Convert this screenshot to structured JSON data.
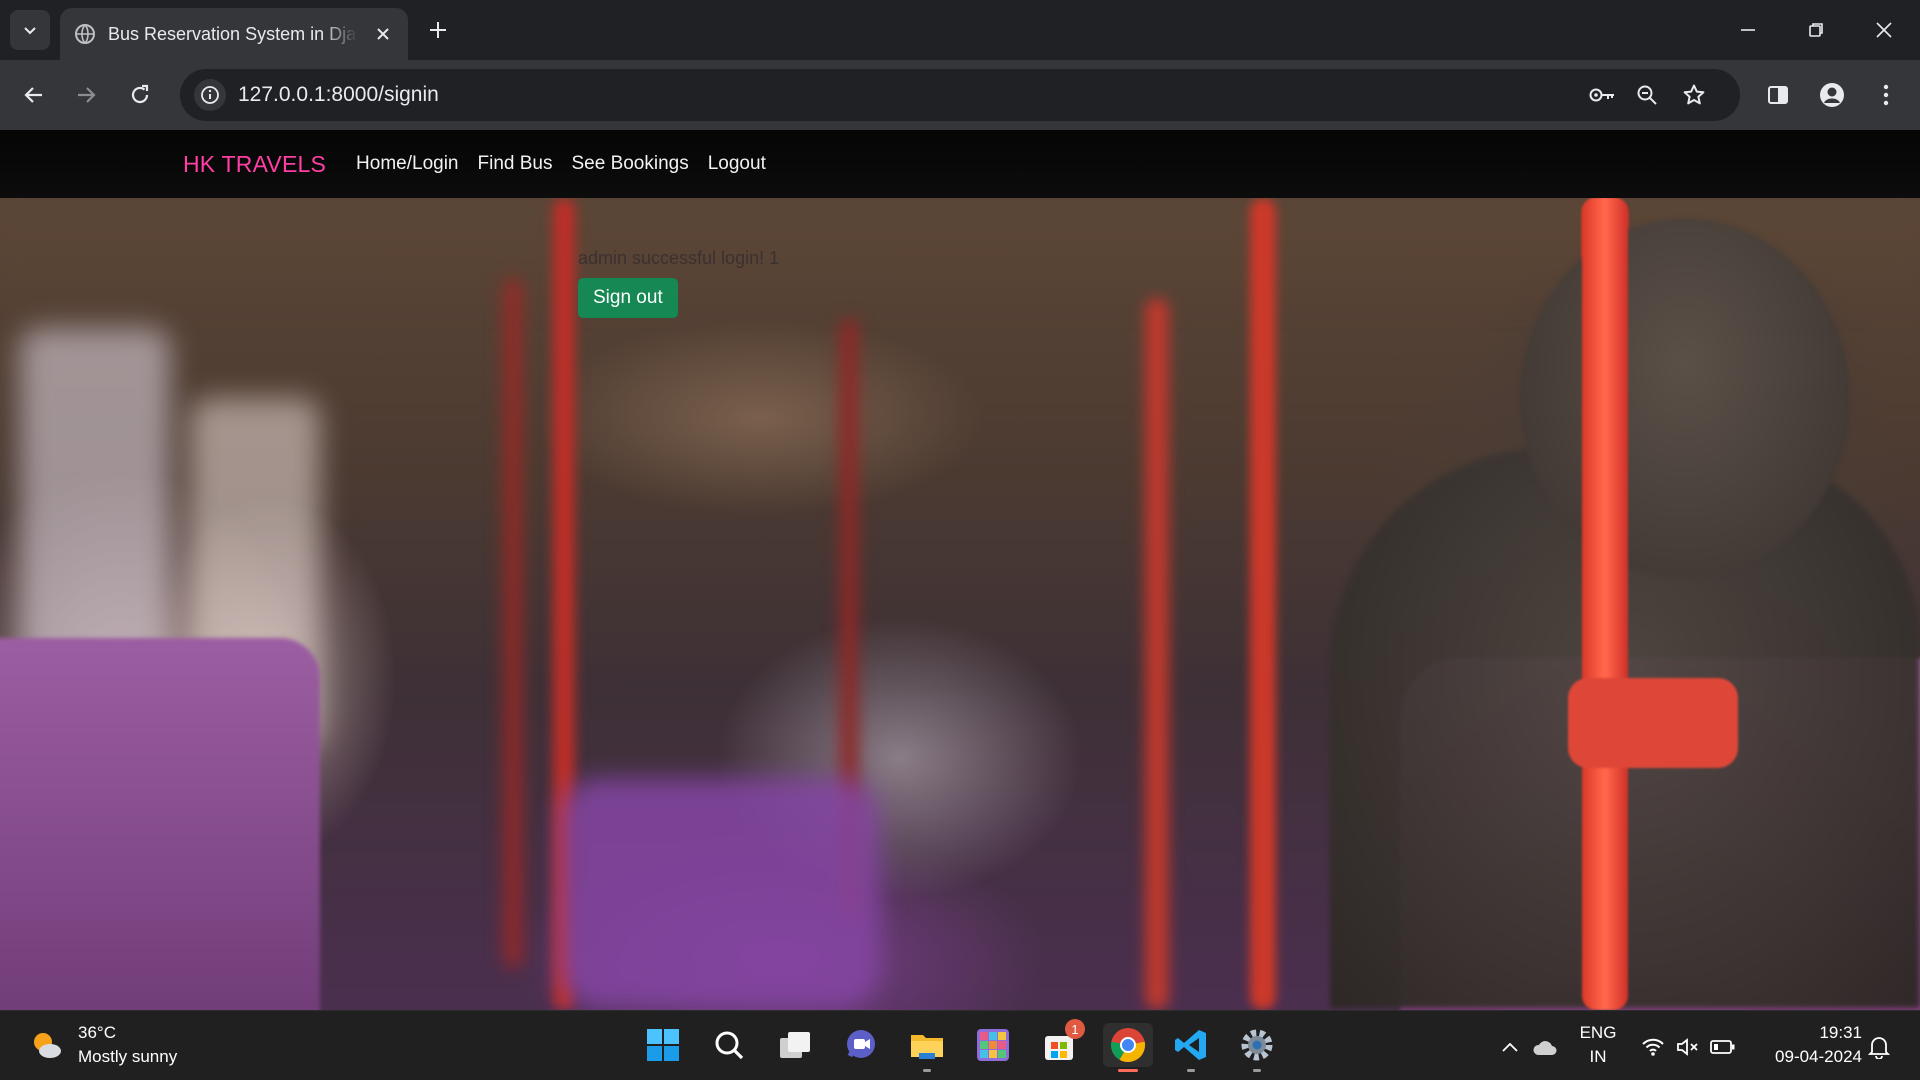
{
  "browser": {
    "tab_title": "Bus Reservation System in Django",
    "url": "127.0.0.1:8000/signin"
  },
  "navbar": {
    "brand": "HK TRAVELS",
    "links": [
      "Home/Login",
      "Find Bus",
      "See Bookings",
      "Logout"
    ]
  },
  "main": {
    "message": "admin successful login! 1",
    "signout_label": "Sign out"
  },
  "taskbar": {
    "weather_temp": "36°C",
    "weather_desc": "Mostly sunny",
    "store_badge": "1",
    "lang_1": "ENG",
    "lang_2": "IN",
    "time": "19:31",
    "date": "09-04-2024"
  },
  "colors": {
    "brand": "#ff3fa4",
    "signout_button": "#198754",
    "navbar_bg": "#050505"
  }
}
